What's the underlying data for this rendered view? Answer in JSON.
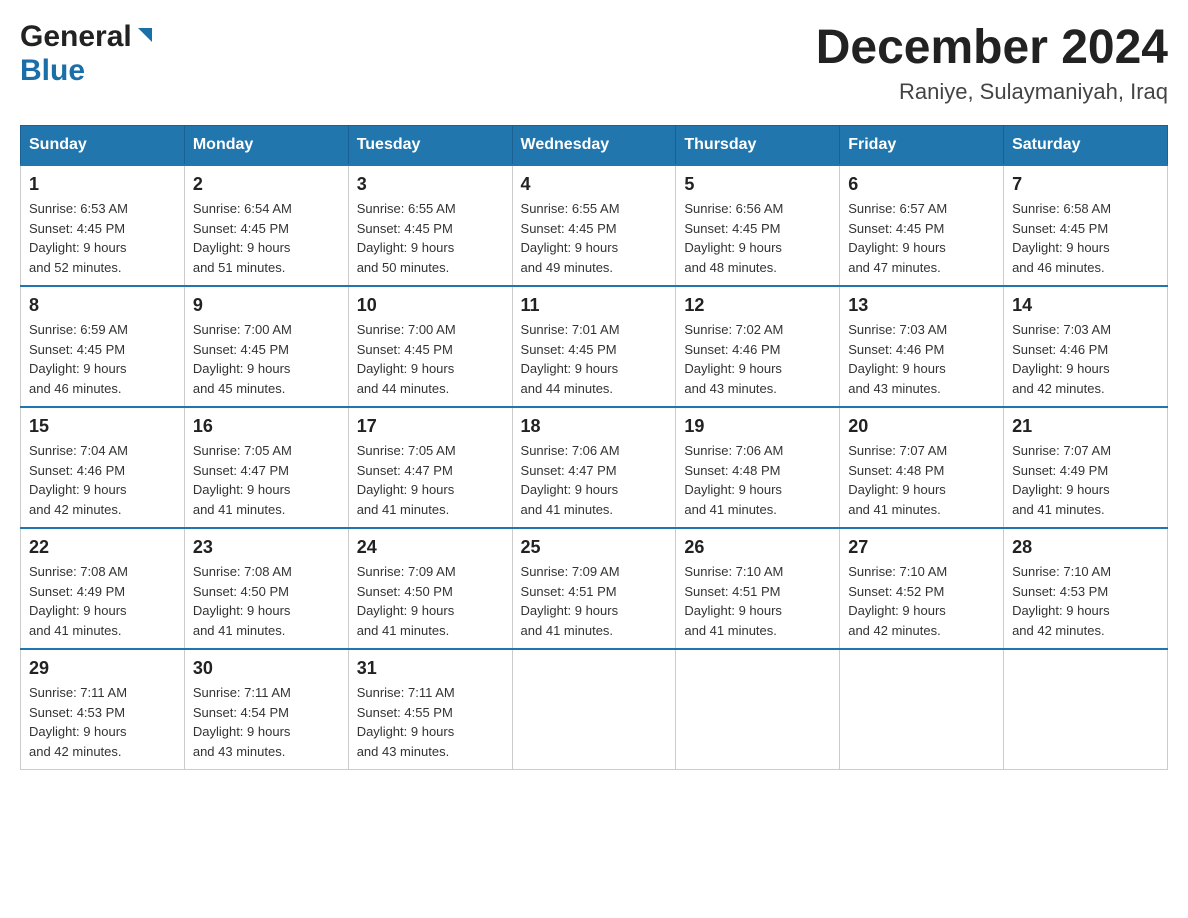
{
  "logo": {
    "general": "General",
    "blue": "Blue"
  },
  "title": {
    "month": "December 2024",
    "location": "Raniye, Sulaymaniyah, Iraq"
  },
  "headers": [
    "Sunday",
    "Monday",
    "Tuesday",
    "Wednesday",
    "Thursday",
    "Friday",
    "Saturday"
  ],
  "weeks": [
    [
      {
        "day": "1",
        "sunrise": "Sunrise: 6:53 AM",
        "sunset": "Sunset: 4:45 PM",
        "daylight": "Daylight: 9 hours",
        "daylight2": "and 52 minutes."
      },
      {
        "day": "2",
        "sunrise": "Sunrise: 6:54 AM",
        "sunset": "Sunset: 4:45 PM",
        "daylight": "Daylight: 9 hours",
        "daylight2": "and 51 minutes."
      },
      {
        "day": "3",
        "sunrise": "Sunrise: 6:55 AM",
        "sunset": "Sunset: 4:45 PM",
        "daylight": "Daylight: 9 hours",
        "daylight2": "and 50 minutes."
      },
      {
        "day": "4",
        "sunrise": "Sunrise: 6:55 AM",
        "sunset": "Sunset: 4:45 PM",
        "daylight": "Daylight: 9 hours",
        "daylight2": "and 49 minutes."
      },
      {
        "day": "5",
        "sunrise": "Sunrise: 6:56 AM",
        "sunset": "Sunset: 4:45 PM",
        "daylight": "Daylight: 9 hours",
        "daylight2": "and 48 minutes."
      },
      {
        "day": "6",
        "sunrise": "Sunrise: 6:57 AM",
        "sunset": "Sunset: 4:45 PM",
        "daylight": "Daylight: 9 hours",
        "daylight2": "and 47 minutes."
      },
      {
        "day": "7",
        "sunrise": "Sunrise: 6:58 AM",
        "sunset": "Sunset: 4:45 PM",
        "daylight": "Daylight: 9 hours",
        "daylight2": "and 46 minutes."
      }
    ],
    [
      {
        "day": "8",
        "sunrise": "Sunrise: 6:59 AM",
        "sunset": "Sunset: 4:45 PM",
        "daylight": "Daylight: 9 hours",
        "daylight2": "and 46 minutes."
      },
      {
        "day": "9",
        "sunrise": "Sunrise: 7:00 AM",
        "sunset": "Sunset: 4:45 PM",
        "daylight": "Daylight: 9 hours",
        "daylight2": "and 45 minutes."
      },
      {
        "day": "10",
        "sunrise": "Sunrise: 7:00 AM",
        "sunset": "Sunset: 4:45 PM",
        "daylight": "Daylight: 9 hours",
        "daylight2": "and 44 minutes."
      },
      {
        "day": "11",
        "sunrise": "Sunrise: 7:01 AM",
        "sunset": "Sunset: 4:45 PM",
        "daylight": "Daylight: 9 hours",
        "daylight2": "and 44 minutes."
      },
      {
        "day": "12",
        "sunrise": "Sunrise: 7:02 AM",
        "sunset": "Sunset: 4:46 PM",
        "daylight": "Daylight: 9 hours",
        "daylight2": "and 43 minutes."
      },
      {
        "day": "13",
        "sunrise": "Sunrise: 7:03 AM",
        "sunset": "Sunset: 4:46 PM",
        "daylight": "Daylight: 9 hours",
        "daylight2": "and 43 minutes."
      },
      {
        "day": "14",
        "sunrise": "Sunrise: 7:03 AM",
        "sunset": "Sunset: 4:46 PM",
        "daylight": "Daylight: 9 hours",
        "daylight2": "and 42 minutes."
      }
    ],
    [
      {
        "day": "15",
        "sunrise": "Sunrise: 7:04 AM",
        "sunset": "Sunset: 4:46 PM",
        "daylight": "Daylight: 9 hours",
        "daylight2": "and 42 minutes."
      },
      {
        "day": "16",
        "sunrise": "Sunrise: 7:05 AM",
        "sunset": "Sunset: 4:47 PM",
        "daylight": "Daylight: 9 hours",
        "daylight2": "and 41 minutes."
      },
      {
        "day": "17",
        "sunrise": "Sunrise: 7:05 AM",
        "sunset": "Sunset: 4:47 PM",
        "daylight": "Daylight: 9 hours",
        "daylight2": "and 41 minutes."
      },
      {
        "day": "18",
        "sunrise": "Sunrise: 7:06 AM",
        "sunset": "Sunset: 4:47 PM",
        "daylight": "Daylight: 9 hours",
        "daylight2": "and 41 minutes."
      },
      {
        "day": "19",
        "sunrise": "Sunrise: 7:06 AM",
        "sunset": "Sunset: 4:48 PM",
        "daylight": "Daylight: 9 hours",
        "daylight2": "and 41 minutes."
      },
      {
        "day": "20",
        "sunrise": "Sunrise: 7:07 AM",
        "sunset": "Sunset: 4:48 PM",
        "daylight": "Daylight: 9 hours",
        "daylight2": "and 41 minutes."
      },
      {
        "day": "21",
        "sunrise": "Sunrise: 7:07 AM",
        "sunset": "Sunset: 4:49 PM",
        "daylight": "Daylight: 9 hours",
        "daylight2": "and 41 minutes."
      }
    ],
    [
      {
        "day": "22",
        "sunrise": "Sunrise: 7:08 AM",
        "sunset": "Sunset: 4:49 PM",
        "daylight": "Daylight: 9 hours",
        "daylight2": "and 41 minutes."
      },
      {
        "day": "23",
        "sunrise": "Sunrise: 7:08 AM",
        "sunset": "Sunset: 4:50 PM",
        "daylight": "Daylight: 9 hours",
        "daylight2": "and 41 minutes."
      },
      {
        "day": "24",
        "sunrise": "Sunrise: 7:09 AM",
        "sunset": "Sunset: 4:50 PM",
        "daylight": "Daylight: 9 hours",
        "daylight2": "and 41 minutes."
      },
      {
        "day": "25",
        "sunrise": "Sunrise: 7:09 AM",
        "sunset": "Sunset: 4:51 PM",
        "daylight": "Daylight: 9 hours",
        "daylight2": "and 41 minutes."
      },
      {
        "day": "26",
        "sunrise": "Sunrise: 7:10 AM",
        "sunset": "Sunset: 4:51 PM",
        "daylight": "Daylight: 9 hours",
        "daylight2": "and 41 minutes."
      },
      {
        "day": "27",
        "sunrise": "Sunrise: 7:10 AM",
        "sunset": "Sunset: 4:52 PM",
        "daylight": "Daylight: 9 hours",
        "daylight2": "and 42 minutes."
      },
      {
        "day": "28",
        "sunrise": "Sunrise: 7:10 AM",
        "sunset": "Sunset: 4:53 PM",
        "daylight": "Daylight: 9 hours",
        "daylight2": "and 42 minutes."
      }
    ],
    [
      {
        "day": "29",
        "sunrise": "Sunrise: 7:11 AM",
        "sunset": "Sunset: 4:53 PM",
        "daylight": "Daylight: 9 hours",
        "daylight2": "and 42 minutes."
      },
      {
        "day": "30",
        "sunrise": "Sunrise: 7:11 AM",
        "sunset": "Sunset: 4:54 PM",
        "daylight": "Daylight: 9 hours",
        "daylight2": "and 43 minutes."
      },
      {
        "day": "31",
        "sunrise": "Sunrise: 7:11 AM",
        "sunset": "Sunset: 4:55 PM",
        "daylight": "Daylight: 9 hours",
        "daylight2": "and 43 minutes."
      },
      null,
      null,
      null,
      null
    ]
  ]
}
